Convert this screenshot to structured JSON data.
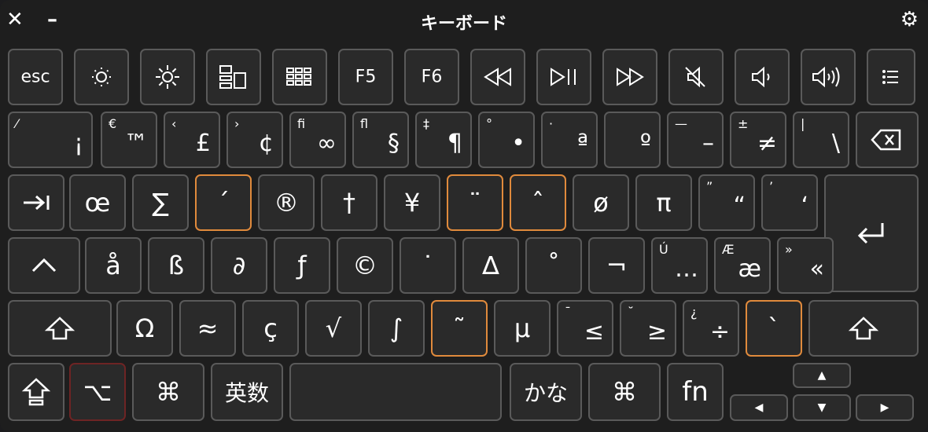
{
  "window": {
    "title": "キーボード",
    "close_label": "✕",
    "minimize_label": "–",
    "settings_label": "⚙"
  },
  "colors": {
    "highlight": "#e08a3c",
    "modifier_active": "#6e2424"
  },
  "fn_row": [
    {
      "label": "esc"
    },
    {
      "icon": "brightness-down-icon"
    },
    {
      "icon": "brightness-up-icon"
    },
    {
      "icon": "mission-control-icon"
    },
    {
      "icon": "launchpad-icon"
    },
    {
      "label": "F5"
    },
    {
      "label": "F6"
    },
    {
      "icon": "rewind-icon"
    },
    {
      "icon": "play-pause-icon"
    },
    {
      "icon": "fast-forward-icon"
    },
    {
      "icon": "mute-icon"
    },
    {
      "icon": "volume-down-icon"
    },
    {
      "icon": "volume-up-icon"
    },
    {
      "icon": "list-icon"
    }
  ],
  "row1": [
    {
      "main": "¡",
      "shift": "⁄"
    },
    {
      "main": "™",
      "shift": "€"
    },
    {
      "main": "£",
      "shift": "‹"
    },
    {
      "main": "¢",
      "shift": "›"
    },
    {
      "main": "∞",
      "shift": "ﬁ"
    },
    {
      "main": "§",
      "shift": "ﬂ"
    },
    {
      "main": "¶",
      "shift": "‡"
    },
    {
      "main": "•",
      "shift": "°"
    },
    {
      "main": "ª",
      "shift": "·"
    },
    {
      "main": "º",
      "shift": ""
    },
    {
      "main": "–",
      "shift": "—"
    },
    {
      "main": "≠",
      "shift": "±"
    },
    {
      "main": "\\",
      "shift": "|"
    }
  ],
  "row2": [
    {
      "main": "œ"
    },
    {
      "main": "∑"
    },
    {
      "main": "´",
      "dead": true
    },
    {
      "main": "®"
    },
    {
      "main": "†"
    },
    {
      "main": "¥"
    },
    {
      "main": "¨",
      "dead": true
    },
    {
      "main": "ˆ",
      "dead": true
    },
    {
      "main": "ø"
    },
    {
      "main": "π"
    },
    {
      "main": "“",
      "shift": "”"
    },
    {
      "main": "‘",
      "shift": "’"
    }
  ],
  "row3": [
    {
      "main": "å"
    },
    {
      "main": "ß"
    },
    {
      "main": "∂"
    },
    {
      "main": "ƒ"
    },
    {
      "main": "©"
    },
    {
      "main": "˙"
    },
    {
      "main": "∆"
    },
    {
      "main": "˚"
    },
    {
      "main": "¬"
    },
    {
      "main": "…",
      "shift": "Ú"
    },
    {
      "main": "æ",
      "shift": "Æ"
    },
    {
      "main": "«",
      "shift": "»"
    }
  ],
  "row4": [
    {
      "main": "Ω"
    },
    {
      "main": "≈"
    },
    {
      "main": "ç"
    },
    {
      "main": "√"
    },
    {
      "main": "∫"
    },
    {
      "main": "˜",
      "dead": true
    },
    {
      "main": "µ"
    },
    {
      "main": "≤",
      "shift": "¯"
    },
    {
      "main": "≥",
      "shift": "˘"
    },
    {
      "main": "÷",
      "shift": "¿"
    },
    {
      "main": "`",
      "dead": true
    }
  ],
  "row5": {
    "command": "⌘",
    "eisu": "英数",
    "kana": "かな",
    "fn": "fn",
    "option": "⌥",
    "arrow_up": "▲",
    "arrow_left": "◀",
    "arrow_down": "▼",
    "arrow_right": "▶"
  }
}
